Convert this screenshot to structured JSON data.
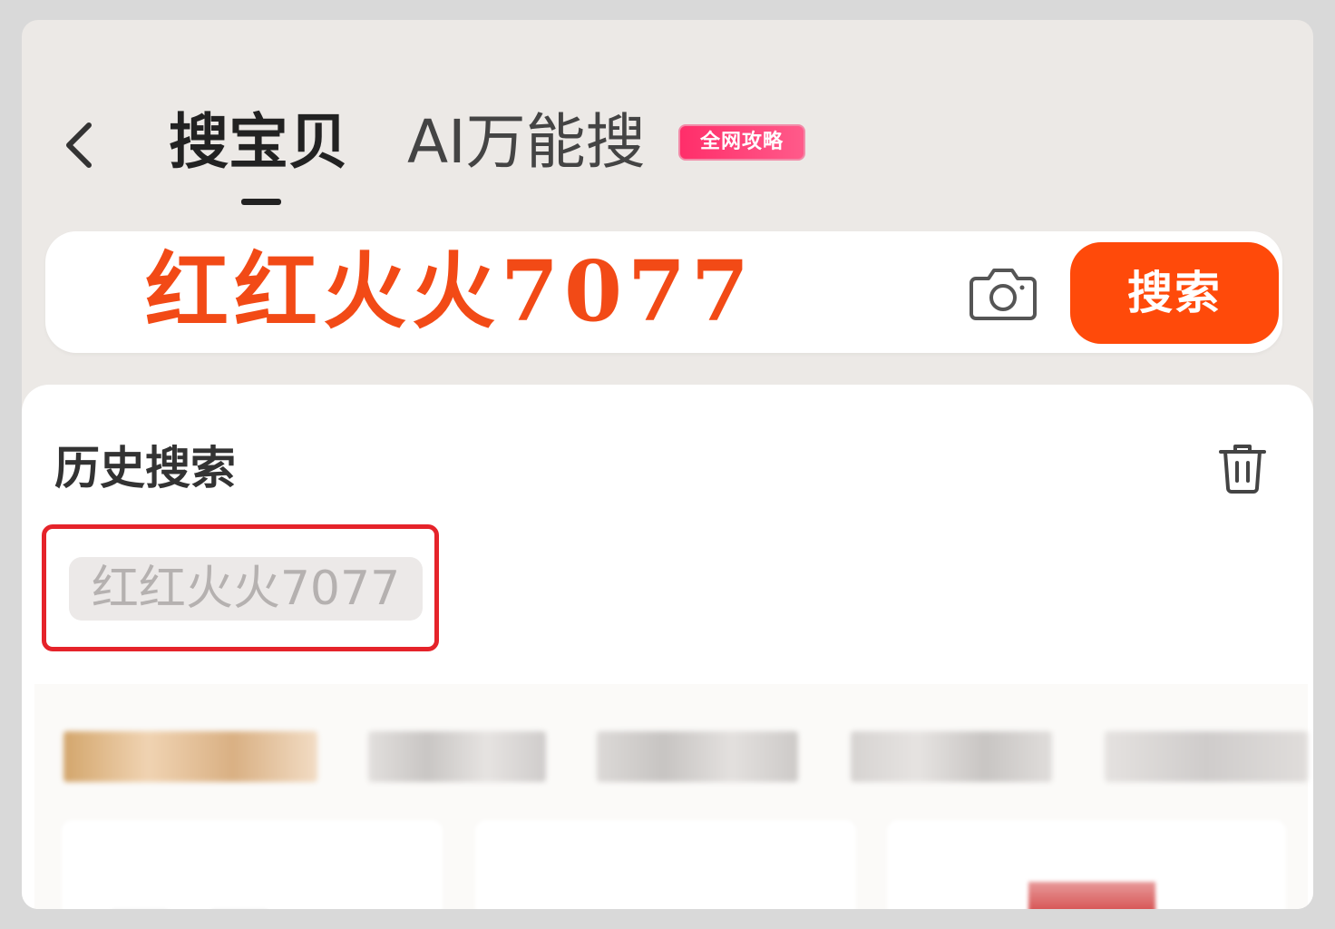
{
  "header": {
    "tabs": [
      {
        "label": "搜宝贝",
        "active": true
      },
      {
        "label": "AI万能搜",
        "active": false
      }
    ],
    "ai_badge": "全网攻略"
  },
  "search": {
    "query_overlay": "红红火火7077",
    "button_label": "搜索"
  },
  "history": {
    "title": "历史搜索",
    "items": [
      {
        "label": "红红火火7077",
        "highlighted": true
      }
    ]
  },
  "icons": {
    "back": "back-chevron-icon",
    "camera": "camera-icon",
    "trash": "trash-icon"
  },
  "colors": {
    "accent": "#ff4a0a",
    "overlay_text": "#f24a16",
    "highlight_border": "#e5232a",
    "badge": "#ff2e6a"
  }
}
